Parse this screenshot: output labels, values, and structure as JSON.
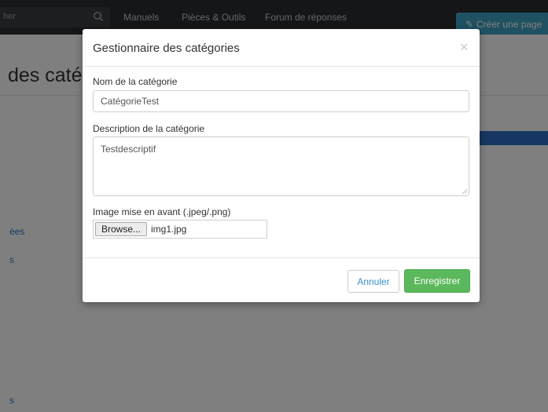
{
  "navbar": {
    "search_placeholder": "her",
    "links": [
      "Manuels",
      "Pièces & Outils",
      "Forum de réponses"
    ],
    "cta_label": "Créer une page",
    "cta_color": "#3fa3c4"
  },
  "page": {
    "title": "des catég",
    "sidebar_links": [
      "ées",
      "s",
      "s"
    ]
  },
  "modal": {
    "title": "Gestionnaire des catégories",
    "close_glyph": "×",
    "name_label": "Nom de la catégorie",
    "name_value": "CatégorieTest",
    "description_label": "Description de la catégorie",
    "description_value": "Testdescriptif",
    "image_label": "Image mise en avant (.jpeg/.png)",
    "browse_label": "Browse...",
    "file_name": "img1.jpg",
    "cancel_label": "Annuler",
    "save_label": "Enregistrer",
    "save_color": "#5cb85c"
  },
  "icons": {
    "search": "search-icon",
    "pencil": "pencil-icon",
    "close": "close-icon",
    "resize": "resize-grip-icon"
  }
}
